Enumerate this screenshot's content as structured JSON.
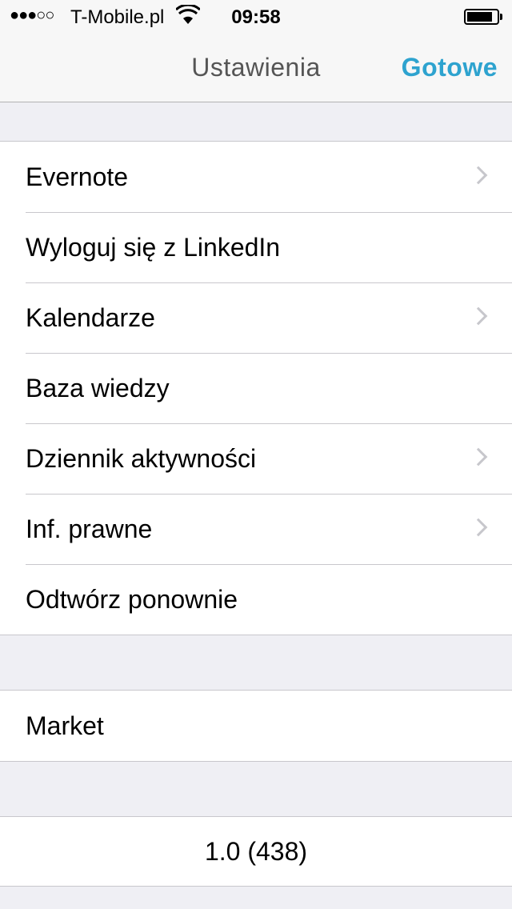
{
  "status_bar": {
    "signal": "●●●○○",
    "carrier": "T-Mobile.pl",
    "time": "09:58",
    "battery_level": 0.85
  },
  "nav": {
    "title": "Ustawienia",
    "done_label": "Gotowe"
  },
  "colors": {
    "accent": "#2ea3cf",
    "background": "#efeff4"
  },
  "settings": {
    "items": [
      {
        "label": "Evernote",
        "chevron": true
      },
      {
        "label": "Wyloguj się z LinkedIn",
        "chevron": false
      },
      {
        "label": "Kalendarze",
        "chevron": true
      },
      {
        "label": "Baza wiedzy",
        "chevron": false
      },
      {
        "label": "Dziennik aktywności",
        "chevron": true
      },
      {
        "label": "Inf. prawne",
        "chevron": true
      },
      {
        "label": "Odtwórz ponownie",
        "chevron": false
      }
    ]
  },
  "market": {
    "label": "Market"
  },
  "version": {
    "text": "1.0 (438)"
  }
}
